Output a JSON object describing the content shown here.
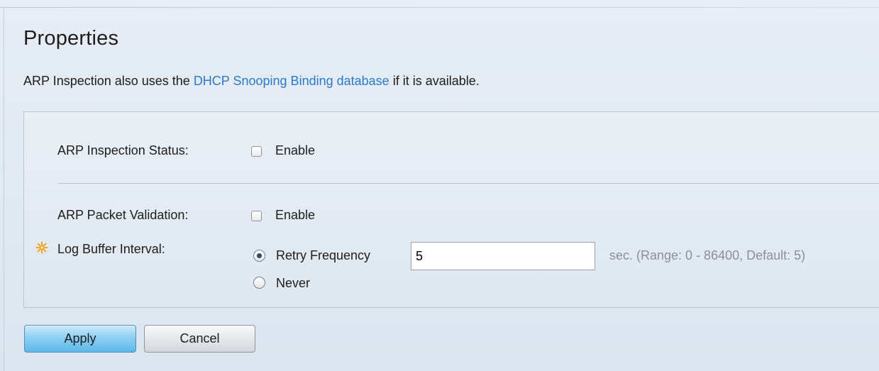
{
  "page": {
    "title": "Properties",
    "intro_before": "ARP Inspection also uses the ",
    "intro_link": "DHCP Snooping Binding database",
    "intro_after": " if it is available."
  },
  "form": {
    "arp_inspection_status": {
      "label": "ARP Inspection Status:",
      "option": "Enable",
      "checked": false
    },
    "arp_packet_validation": {
      "label": "ARP Packet Validation:",
      "option": "Enable",
      "checked": false
    },
    "log_buffer_interval": {
      "label": "Log Buffer Interval:",
      "required_icon": "required-asterisk-icon",
      "options": [
        {
          "label": "Retry Frequency",
          "selected": true
        },
        {
          "label": "Never",
          "selected": false
        }
      ],
      "value": "5",
      "hint": "sec. (Range: 0 - 86400, Default: 5)"
    }
  },
  "buttons": {
    "apply": "Apply",
    "cancel": "Cancel"
  },
  "colors": {
    "link": "#2b7ac9",
    "hint": "#8a9098",
    "apply_button": "#5cb7e8",
    "required_star": "#f2a01e"
  }
}
